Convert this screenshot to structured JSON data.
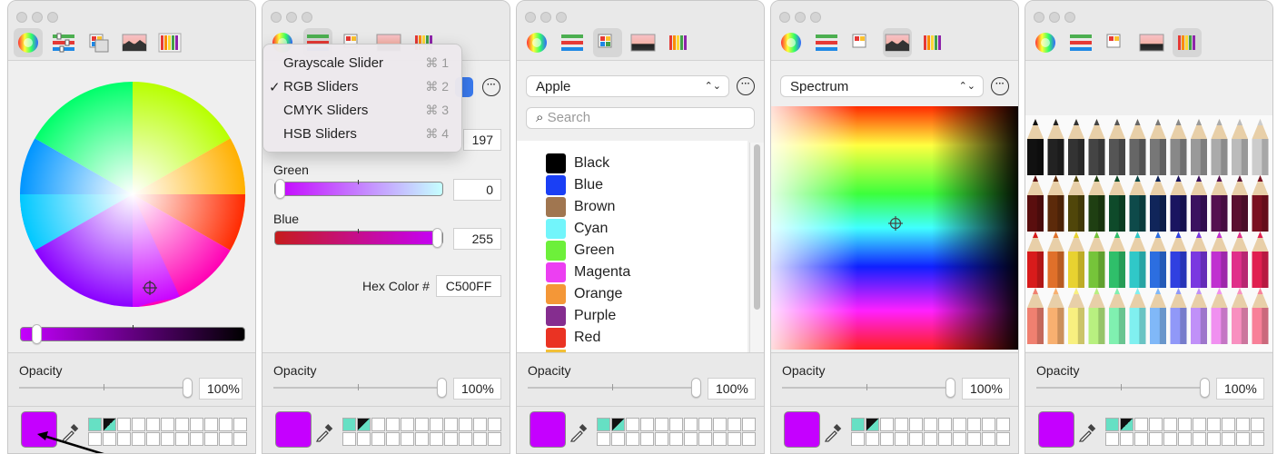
{
  "panels": {
    "wheel": {
      "opacity_label": "Opacity",
      "opacity_value": "100%",
      "brightness_level": 0.05,
      "opacity_level": 1.0
    },
    "sliders": {
      "menu": [
        {
          "label": "Grayscale Slider",
          "shortcut": "⌘ 1",
          "checked": false
        },
        {
          "label": "RGB Sliders",
          "shortcut": "⌘ 2",
          "checked": true
        },
        {
          "label": "CMYK Sliders",
          "shortcut": "⌘ 3",
          "checked": false
        },
        {
          "label": "HSB Sliders",
          "shortcut": "⌘ 4",
          "checked": false
        }
      ],
      "checkmark": "✓",
      "red_value": "197",
      "green_label": "Green",
      "green_value": "0",
      "blue_label": "Blue",
      "blue_value": "255",
      "hex_label": "Hex Color #",
      "hex_value": "C500FF",
      "opacity_label": "Opacity",
      "opacity_value": "100%"
    },
    "palettes": {
      "palette_name": "Apple",
      "search_placeholder": "Search",
      "colors": [
        {
          "name": "Black",
          "hex": "#000000"
        },
        {
          "name": "Blue",
          "hex": "#1a3ff5"
        },
        {
          "name": "Brown",
          "hex": "#a07650"
        },
        {
          "name": "Cyan",
          "hex": "#72f5fb"
        },
        {
          "name": "Green",
          "hex": "#6df03a"
        },
        {
          "name": "Magenta",
          "hex": "#ec3ff2"
        },
        {
          "name": "Orange",
          "hex": "#f49737"
        },
        {
          "name": "Purple",
          "hex": "#852d8f"
        },
        {
          "name": "Red",
          "hex": "#ea3323"
        }
      ],
      "opacity_label": "Opacity",
      "opacity_value": "100%"
    },
    "spectrum": {
      "source_name": "Spectrum",
      "opacity_label": "Opacity",
      "opacity_value": "100%"
    },
    "pencils": {
      "opacity_label": "Opacity",
      "opacity_value": "100%"
    }
  },
  "current_color": "#c500ff",
  "more_glyph": "···",
  "popup_arrows": "⌃⌄",
  "toolbar_icons": [
    "color-wheel-icon",
    "color-sliders-icon",
    "color-palettes-icon",
    "image-palettes-icon",
    "pencils-icon"
  ]
}
